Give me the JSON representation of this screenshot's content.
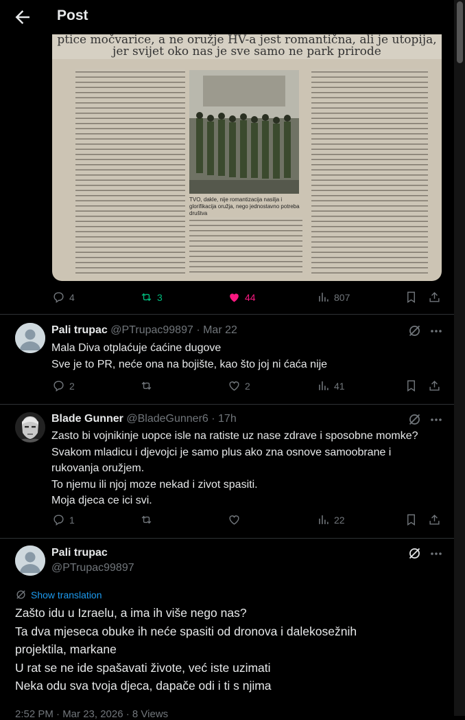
{
  "header": {
    "title": "Post"
  },
  "image": {
    "headline_line1": "ptice močvarice, a ne oružje HV-a jest romantična, ali je utopija,",
    "headline_line2": "jer svijet oko nas je sve samo ne park prirode",
    "caption": "TVO, dakle, nije romantizacija nasilja i glorifikacija oružja, nego jednostavno potreba društva"
  },
  "main_stats": {
    "replies": "4",
    "reposts": "3",
    "likes": "44",
    "views": "807"
  },
  "replies": [
    {
      "name": "Pali trupac",
      "handle": "@PTrupac99897",
      "time": "· Mar 22",
      "lines": [
        "Mala Diva otplaćuje ćaćine dugove",
        "Sve je to PR, neće ona na bojište, kao što joj ni ćaća nije"
      ],
      "stats": {
        "replies": "2",
        "reposts": "",
        "likes": "2",
        "views": "41"
      }
    },
    {
      "name": "Blade Gunner",
      "handle": "@BladeGunner6",
      "time": "· 17h",
      "lines": [
        "Zasto bi vojnikinje uopce isle na ratiste uz nase zdrave i sposobne momke?",
        "Svakom mladicu i djevojci je samo plus ako zna osnove samoobrane i",
        "rukovanja oružjem.",
        "To njemu ili njoj moze nekad i zivot spasiti.",
        "Moja djeca ce ici svi."
      ],
      "stats": {
        "replies": "1",
        "reposts": "",
        "likes": "",
        "views": "22"
      }
    }
  ],
  "focused": {
    "name": "Pali trupac",
    "handle": "@PTrupac99897",
    "translation": "Show translation",
    "lines": [
      "Zašto idu u Izraelu, a ima ih više nego nas?",
      "Ta dva mjeseca obuke ih neće spasiti od dronova i dalekosežnih",
      "projektila, markane",
      "U rat se ne ide spašavati živote, već iste uzimati",
      "Neka odu sva tvoja djeca, dapače odi i ti s njima"
    ],
    "footer": "2:52 PM · Mar 23, 2026 · 8 Views"
  },
  "colors": {
    "accent": "#1d9bf0",
    "like": "#f91880",
    "repost": "#00ba7c",
    "muted": "#71767b"
  }
}
